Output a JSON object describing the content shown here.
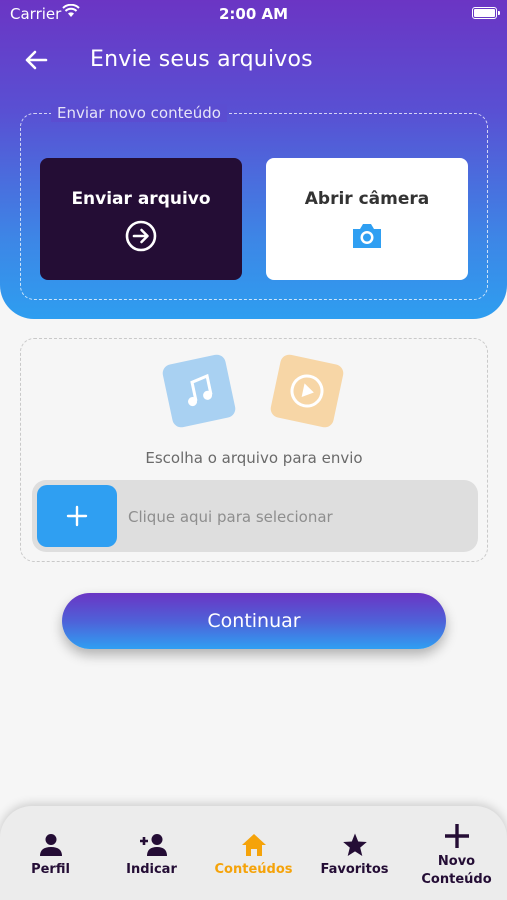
{
  "status_bar": {
    "carrier": "Carrier",
    "time": "2:00 AM"
  },
  "header": {
    "title": "Envie seus arquivos",
    "back_icon": "arrow-left-icon"
  },
  "upload_section": {
    "label": "Enviar novo conteúdo",
    "send_file": {
      "label": "Enviar arquivo",
      "icon": "arrow-circle-right-icon"
    },
    "open_camera": {
      "label": "Abrir câmera",
      "icon": "camera-icon"
    }
  },
  "file_picker": {
    "instruction": "Escolha o arquivo para envio",
    "placeholder": "Clique aqui para selecionar",
    "add_icon": "plus-icon"
  },
  "continue_label": "Continuar",
  "tabbar": {
    "items": [
      {
        "label": "Perfil",
        "icon": "person-icon",
        "active": false
      },
      {
        "label": "Indicar",
        "icon": "add-person-icon",
        "active": false
      },
      {
        "label": "Conteúdos",
        "icon": "home-icon",
        "active": true
      },
      {
        "label": "Favoritos",
        "icon": "star-icon",
        "active": false
      },
      {
        "label": "Novo\nConteúdo",
        "icon": "plus-icon",
        "active": false
      }
    ]
  },
  "colors": {
    "primary_purple": "#6b35c4",
    "primary_blue": "#2f9ff2",
    "dark_card": "#240d35",
    "active_tab": "#f5a30a"
  }
}
